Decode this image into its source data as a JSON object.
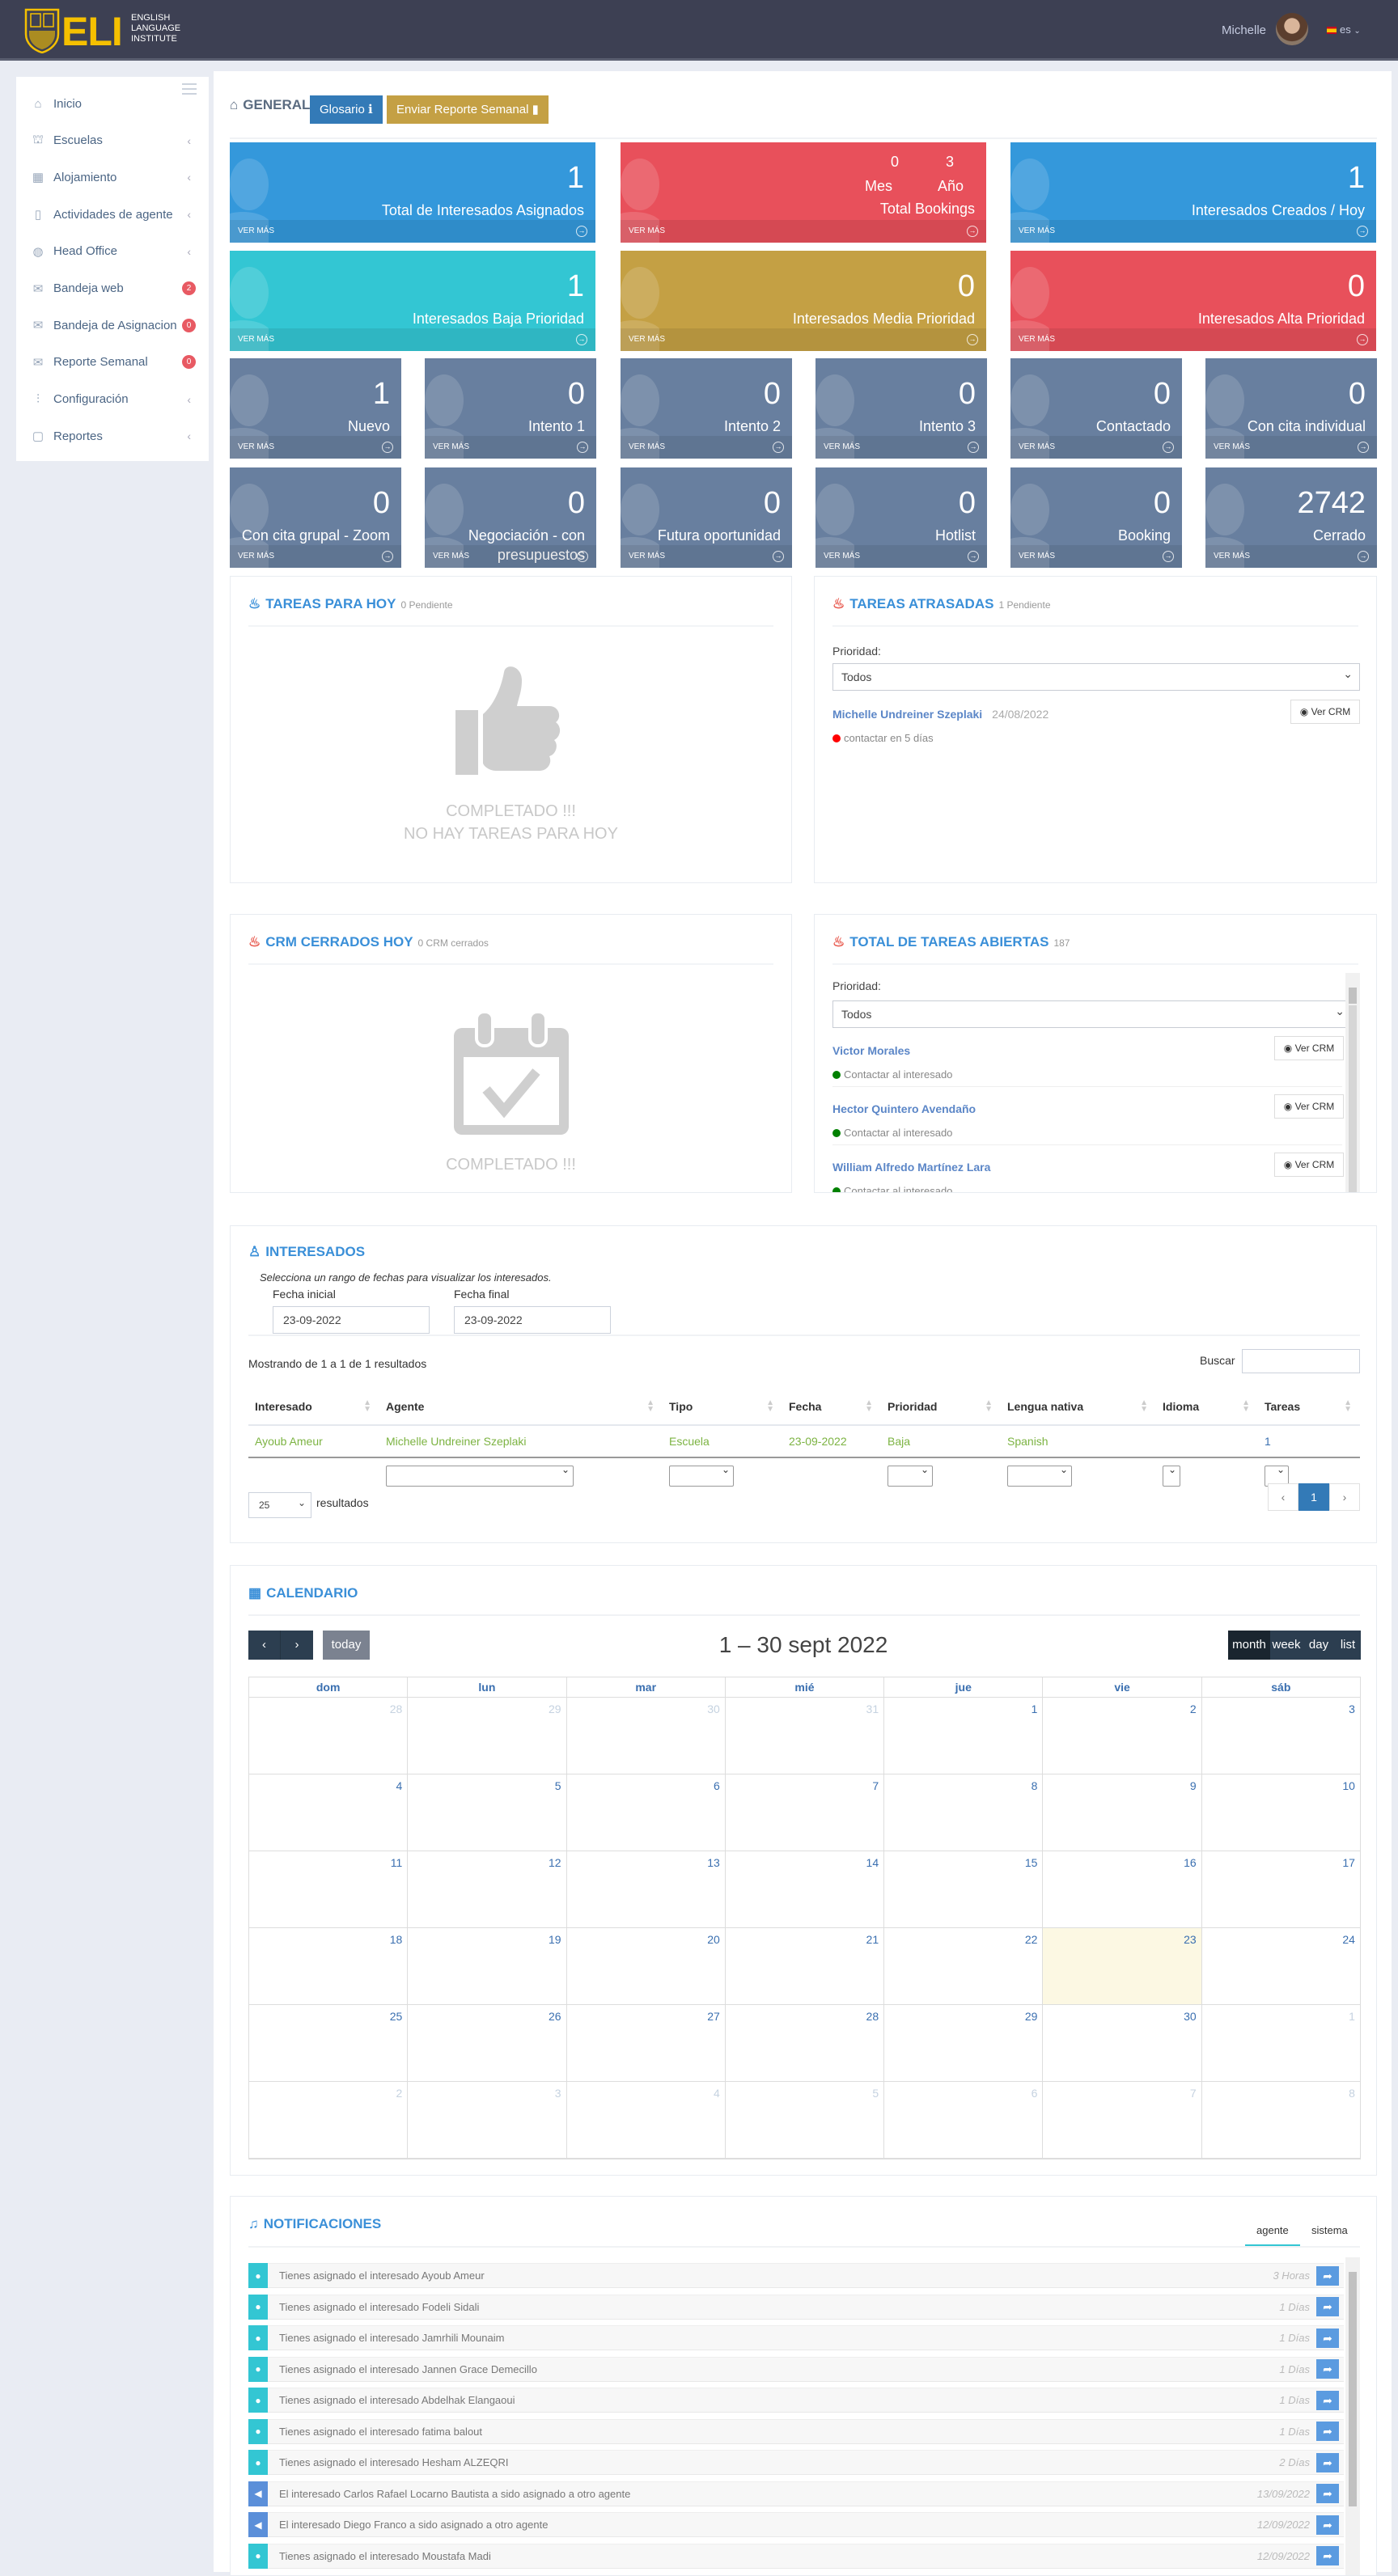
{
  "header": {
    "logo_text": "ELI",
    "logo_sub": [
      "ENGLISH",
      "LANGUAGE",
      "INSTITUTE"
    ],
    "user": "Michelle",
    "lang": "es"
  },
  "sidebar": {
    "items": [
      {
        "label": "Inicio",
        "icon": "home-icon",
        "arrow": false
      },
      {
        "label": "Escuelas",
        "icon": "school-icon",
        "arrow": true
      },
      {
        "label": "Alojamiento",
        "icon": "calendar-icon",
        "arrow": true
      },
      {
        "label": "Actividades de agente",
        "icon": "phone-icon",
        "arrow": true
      },
      {
        "label": "Head Office",
        "icon": "globe-icon",
        "arrow": true
      },
      {
        "label": "Bandeja web",
        "icon": "mail-icon",
        "badge": "2"
      },
      {
        "label": "Bandeja de Asignacion",
        "icon": "mail-icon",
        "badge": "0"
      },
      {
        "label": "Reporte Semanal",
        "icon": "mail-icon",
        "badge": "0"
      },
      {
        "label": "Configuración",
        "icon": "sliders-icon",
        "arrow": true
      },
      {
        "label": "Reportes",
        "icon": "file-icon",
        "arrow": true
      }
    ]
  },
  "general": {
    "title": "GENERAL",
    "glosario": "Glosario",
    "enviar": "Enviar Reporte Semanal",
    "ver_mas": "VER MÁS",
    "bookings": {
      "mes_value": "0",
      "anio_value": "3",
      "mes_label": "Mes",
      "anio_label": "Año",
      "label": "Total Bookings",
      "color": "#e8505b"
    },
    "big_tiles": [
      {
        "value": "1",
        "label": "Total de Interesados Asignados",
        "color": "#3498db"
      },
      {
        "value": "1",
        "label": "Interesados Creados / Hoy",
        "color": "#3498db"
      },
      {
        "value": "1",
        "label": "Interesados Baja Prioridad",
        "color": "#33c6d3"
      },
      {
        "value": "0",
        "label": "Interesados Media Prioridad",
        "color": "#c4a044"
      },
      {
        "value": "0",
        "label": "Interesados Alta Prioridad",
        "color": "#e8505b"
      }
    ],
    "small_color": "#687f9f",
    "small_tiles": [
      {
        "value": "1",
        "label": "Nuevo"
      },
      {
        "value": "0",
        "label": "Intento 1"
      },
      {
        "value": "0",
        "label": "Intento 2"
      },
      {
        "value": "0",
        "label": "Intento 3"
      },
      {
        "value": "0",
        "label": "Contactado"
      },
      {
        "value": "0",
        "label": "Con cita individual"
      },
      {
        "value": "0",
        "label": "Con cita grupal - Zoom"
      },
      {
        "value": "0",
        "label": "Negociación - con presupuestos"
      },
      {
        "value": "0",
        "label": "Futura oportunidad"
      },
      {
        "value": "0",
        "label": "Hotlist"
      },
      {
        "value": "0",
        "label": "Booking"
      },
      {
        "value": "2742",
        "label": "Cerrado"
      }
    ]
  },
  "tareas_hoy": {
    "title": "TAREAS PARA HOY",
    "count": "0 Pendiente",
    "empty_1": "COMPLETADO !!!",
    "empty_2": "NO HAY TAREAS PARA HOY"
  },
  "tareas_atrasadas": {
    "title": "TAREAS ATRASADAS",
    "count": "1 Pendiente",
    "prioridad_label": "Prioridad:",
    "select": "Todos",
    "ver_crm": "Ver CRM",
    "items": [
      {
        "name": "Michelle Undreiner Szeplaki",
        "date": "24/08/2022",
        "status": "contactar en 5 días",
        "status_color": "#ff0000"
      }
    ]
  },
  "crm_cerrados": {
    "title": "CRM CERRADOS HOY",
    "count": "0 CRM cerrados",
    "empty_1": "COMPLETADO !!!"
  },
  "tareas_abiertas": {
    "title": "TOTAL DE TAREAS ABIERTAS",
    "count": "187",
    "prioridad_label": "Prioridad:",
    "select": "Todos",
    "ver_crm": "Ver CRM",
    "items": [
      {
        "name": "Victor Morales",
        "status": "Contactar al interesado",
        "status_color": "#008000"
      },
      {
        "name": "Hector Quintero Avendaño",
        "status": "Contactar al interesado",
        "status_color": "#008000"
      },
      {
        "name": "William Alfredo Martínez Lara",
        "status": "Contactar al interesado",
        "status_color": "#008000"
      }
    ]
  },
  "interesados": {
    "title": "INTERESADOS",
    "hint": "Selecciona un rango de fechas para visualizar los interesados.",
    "fecha_inicial_label": "Fecha inicial",
    "fecha_inicial": "23-09-2022",
    "fecha_final_label": "Fecha final",
    "fecha_final": "23-09-2022",
    "showing": "Mostrando de 1 a 1 de 1 resultados",
    "buscar": "Buscar",
    "columns": [
      "Interesado",
      "Agente",
      "Tipo",
      "Fecha",
      "Prioridad",
      "Lengua nativa",
      "Idioma",
      "Tareas"
    ],
    "rows": [
      [
        "Ayoub Ameur",
        "Michelle Undreiner Szeplaki",
        "Escuela",
        "23-09-2022",
        "Baja",
        "Spanish",
        "",
        "1"
      ]
    ],
    "page_size": "25",
    "resultados": "resultados",
    "pages": [
      "‹",
      "1",
      "›"
    ]
  },
  "calendario": {
    "title": "CALENDARIO",
    "range": "1 – 30 sept 2022",
    "today": "today",
    "views": [
      "month",
      "week",
      "day",
      "list"
    ],
    "days": [
      "dom",
      "lun",
      "mar",
      "mié",
      "jue",
      "vie",
      "sáb"
    ],
    "today_date": 23,
    "weeks": [
      [
        28,
        29,
        30,
        31,
        1,
        2,
        3
      ],
      [
        4,
        5,
        6,
        7,
        8,
        9,
        10
      ],
      [
        11,
        12,
        13,
        14,
        15,
        16,
        17
      ],
      [
        18,
        19,
        20,
        21,
        22,
        23,
        24
      ],
      [
        25,
        26,
        27,
        28,
        29,
        30,
        1
      ],
      [
        2,
        3,
        4,
        5,
        6,
        7,
        8
      ]
    ]
  },
  "notificaciones": {
    "title": "NOTIFICACIONES",
    "tabs": [
      "agente",
      "sistema"
    ],
    "items": [
      {
        "text": "Tienes asignado el interesado Ayoub Ameur",
        "time": "3 Horas",
        "type": "asignado"
      },
      {
        "text": "Tienes asignado el interesado Fodeli Sidali",
        "time": "1 Días",
        "type": "asignado"
      },
      {
        "text": "Tienes asignado el interesado Jamrhili Mounaim",
        "time": "1 Días",
        "type": "asignado"
      },
      {
        "text": "Tienes asignado el interesado Jannen Grace Demecillo",
        "time": "1 Días",
        "type": "asignado"
      },
      {
        "text": "Tienes asignado el interesado Abdelhak Elangaoui",
        "time": "1 Días",
        "type": "asignado"
      },
      {
        "text": "Tienes asignado el interesado fatima balout",
        "time": "1 Días",
        "type": "asignado"
      },
      {
        "text": "Tienes asignado el interesado Hesham ALZEQRI",
        "time": "2 Días",
        "type": "asignado"
      },
      {
        "text": "El interesado Carlos Rafael Locarno Bautista a sido asignado a otro agente",
        "time": "13/09/2022",
        "type": "reasignado"
      },
      {
        "text": "El interesado Diego Franco a sido asignado a otro agente",
        "time": "12/09/2022",
        "type": "reasignado"
      },
      {
        "text": "Tienes asignado el interesado Moustafa Madi",
        "time": "12/09/2022",
        "type": "asignado"
      }
    ]
  }
}
